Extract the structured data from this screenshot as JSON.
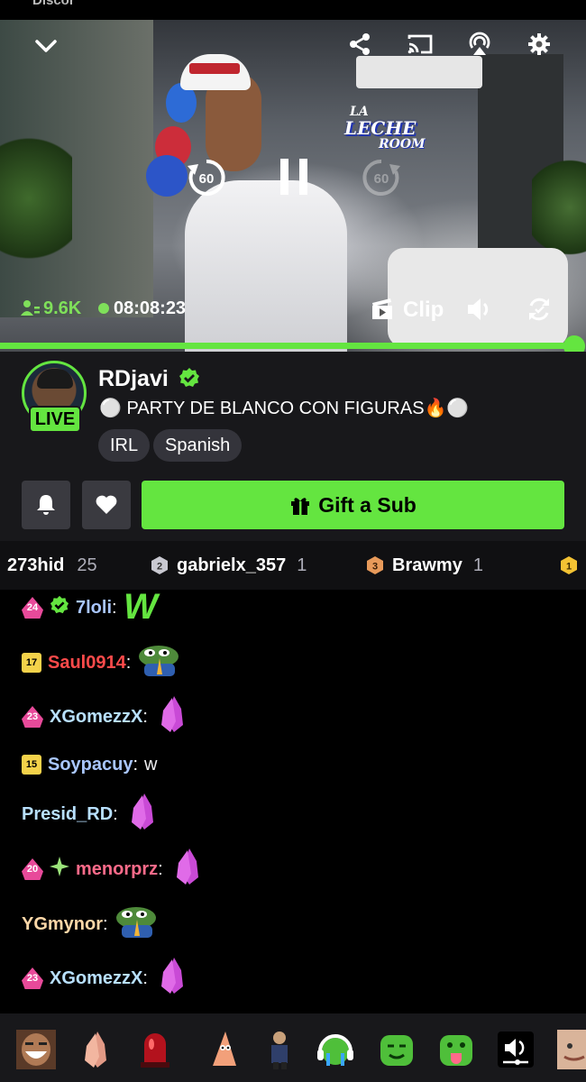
{
  "status_bar": {
    "partial_text": "Discor"
  },
  "stream": {
    "viewer_count": "9.6K",
    "uptime": "08:08:23",
    "clip_label": "Clip",
    "seek_back_seconds": "60",
    "seek_forward_seconds": "60",
    "progress": 0.98,
    "scene_sign": {
      "line1": "LA",
      "line2": "LECHE",
      "line3": "ROOM"
    }
  },
  "channel": {
    "name": "RDjavi",
    "live_badge": "LIVE",
    "title": "⚪ PARTY DE BLANCO CON FIGURAS🔥⚪",
    "tags": [
      "IRL",
      "Spanish"
    ],
    "gift_label": "Gift a Sub"
  },
  "leaderboard": [
    {
      "rank": "",
      "name": "273hid",
      "count": "25"
    },
    {
      "rank": "2",
      "name": "gabrielx_357",
      "count": "1"
    },
    {
      "rank": "3",
      "name": "Brawmy",
      "count": "1"
    },
    {
      "rank": "1",
      "name": "",
      "count": ""
    }
  ],
  "chat": [
    {
      "badge": "24",
      "badge_type": "pink",
      "verified": true,
      "user": "7loli",
      "color": "#a9c6ff",
      "text": "",
      "emote": "W"
    },
    {
      "badge": "17",
      "badge_type": "yellow",
      "user": "Saul0914",
      "color": "#ff4a4a",
      "text": "",
      "emote": "pepe-pray"
    },
    {
      "badge": "23",
      "badge_type": "pink",
      "user": "XGomezzX",
      "color": "#b8e0ff",
      "text": "",
      "emote": "pray-hands"
    },
    {
      "badge": "15",
      "badge_type": "yellow",
      "user": "Soypacuy",
      "color": "#a9c6ff",
      "text": "w",
      "emote": ""
    },
    {
      "badge": "",
      "badge_type": "",
      "user": "Presid_RD",
      "color": "#b8e0ff",
      "text": "",
      "emote": "pray-hands"
    },
    {
      "badge": "20",
      "badge_type": "pink",
      "sparkle": true,
      "user": "menorprz",
      "color": "#ff6b8a",
      "text": "",
      "emote": "pray-hands"
    },
    {
      "badge": "",
      "badge_type": "",
      "user": "YGmynor",
      "color": "#ffd8a8",
      "text": "",
      "emote": "pepe-pray"
    },
    {
      "badge": "23",
      "badge_type": "pink",
      "user": "XGomezzX",
      "color": "#b8e0ff",
      "text": "",
      "emote": "pray-hands"
    }
  ],
  "emote_bar": [
    "laughing-face",
    "pray-hands",
    "red-siren",
    "patrick",
    "dancing-man",
    "crying-headphones",
    "green-blob-sly",
    "green-blob-tongue",
    "audio-toggle",
    "face-partial"
  ],
  "colors": {
    "accent": "#64e540",
    "panel": "#18181b",
    "leaderboard": "#101012"
  }
}
